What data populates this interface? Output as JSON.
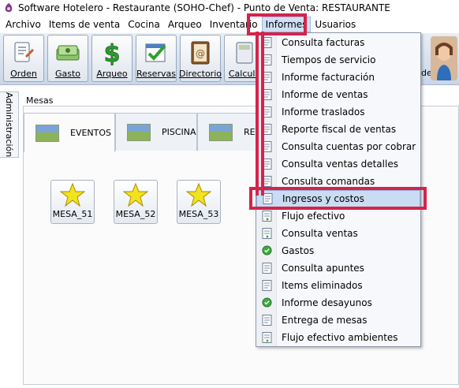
{
  "window": {
    "title": "Software  Hotelero - Restaurante (SOHO-Chef)  - Punto de Venta: RESTAURANTE",
    "app_icon": "app-logo-icon"
  },
  "menubar": {
    "items": [
      "Archivo",
      "Items de venta",
      "Cocina",
      "Arqueo",
      "Inventario",
      "Informes",
      "Usuarios"
    ],
    "open": "Informes"
  },
  "toolbar": {
    "buttons": [
      {
        "label": "Orden",
        "icon": "order-icon"
      },
      {
        "label": "Gasto",
        "icon": "money-icon"
      },
      {
        "label": "Arqueo",
        "icon": "dollar-icon"
      },
      {
        "label": "Reservas",
        "icon": "calendar-check-icon"
      },
      {
        "label": "Directorio",
        "icon": "address-book-icon"
      },
      {
        "label": "Calcula",
        "icon": "calculator-icon"
      }
    ],
    "trailing_label": "des",
    "avatar": "operator-avatar"
  },
  "sidebar": {
    "tab_label": "Administración"
  },
  "main": {
    "section_label": "Mesas",
    "zone_tabs": [
      "EVENTOS",
      "PISCINA",
      "RE"
    ],
    "active_zone": "EVENTOS",
    "mesas": [
      {
        "label": "MESA_51",
        "icon": "star-icon"
      },
      {
        "label": "MESA_52",
        "icon": "star-icon"
      },
      {
        "label": "MESA_53",
        "icon": "star-icon"
      }
    ]
  },
  "informes_menu": {
    "items": [
      {
        "label": "Consulta facturas",
        "icon": "report-icon"
      },
      {
        "label": "Tiempos de servicio",
        "icon": "report-icon"
      },
      {
        "label": "Informe facturación",
        "icon": "report-icon"
      },
      {
        "label": "Informe de ventas",
        "icon": "report-icon"
      },
      {
        "label": "Informe traslados",
        "icon": "report-icon"
      },
      {
        "label": "Reporte fiscal de ventas",
        "icon": "report-icon"
      },
      {
        "label": "Consulta cuentas por cobrar",
        "icon": "report-icon"
      },
      {
        "label": "Consulta ventas detalles",
        "icon": "report-icon"
      },
      {
        "label": "Consulta comandas",
        "icon": "report-icon"
      },
      {
        "label": "Ingresos y costos",
        "icon": "report-icon"
      },
      {
        "label": "Flujo efectivo",
        "icon": "flow-report-icon"
      },
      {
        "label": "Consulta ventas",
        "icon": "flow-report-icon"
      },
      {
        "label": "Gastos",
        "icon": "check-circle-icon"
      },
      {
        "label": "Consulta apuntes",
        "icon": "report-icon"
      },
      {
        "label": "Items eliminados",
        "icon": "report-icon"
      },
      {
        "label": "Informe desayunos",
        "icon": "check-circle-icon"
      },
      {
        "label": "Entrega de mesas",
        "icon": "report-icon"
      },
      {
        "label": "Flujo efectivo ambientes",
        "icon": "flow-report-icon"
      }
    ],
    "highlighted": "Ingresos y costos"
  },
  "colors": {
    "highlight_border": "#d5234a",
    "menu_hover": "#c9dcf3",
    "toolbar_bg": "#c9d6e8"
  }
}
